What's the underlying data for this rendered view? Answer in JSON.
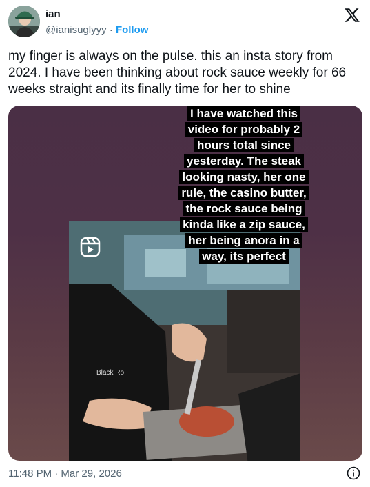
{
  "author": {
    "name": "ian",
    "handle": "@ianisuglyyy",
    "separator": " · ",
    "follow_label": "Follow"
  },
  "platform_icon": "x-logo-icon",
  "tweet": {
    "text": "my finger is always on the pulse. this an insta story from 2024. I have been thinking about rock sauce weekly for 66 weeks straight and its finally time for her to shine"
  },
  "media": {
    "caption_lines": [
      "I have watched this",
      "video for probably 2",
      "hours total since",
      "yesterday. The steak",
      "looking nasty, her one",
      "rule, the casino butter,",
      "the rock sauce being",
      "kinda like a zip sauce,",
      "her being anora in a",
      "way, its perfect"
    ],
    "shirt_text": "Black Ro",
    "reel_icon": "instagram-reels-icon"
  },
  "footer": {
    "timestamp": "11:48 PM · Mar 29, 2026",
    "info_icon": "info-icon"
  },
  "colors": {
    "accent": "#1d9bf0",
    "text": "#0f1419",
    "secondary": "#536471"
  }
}
